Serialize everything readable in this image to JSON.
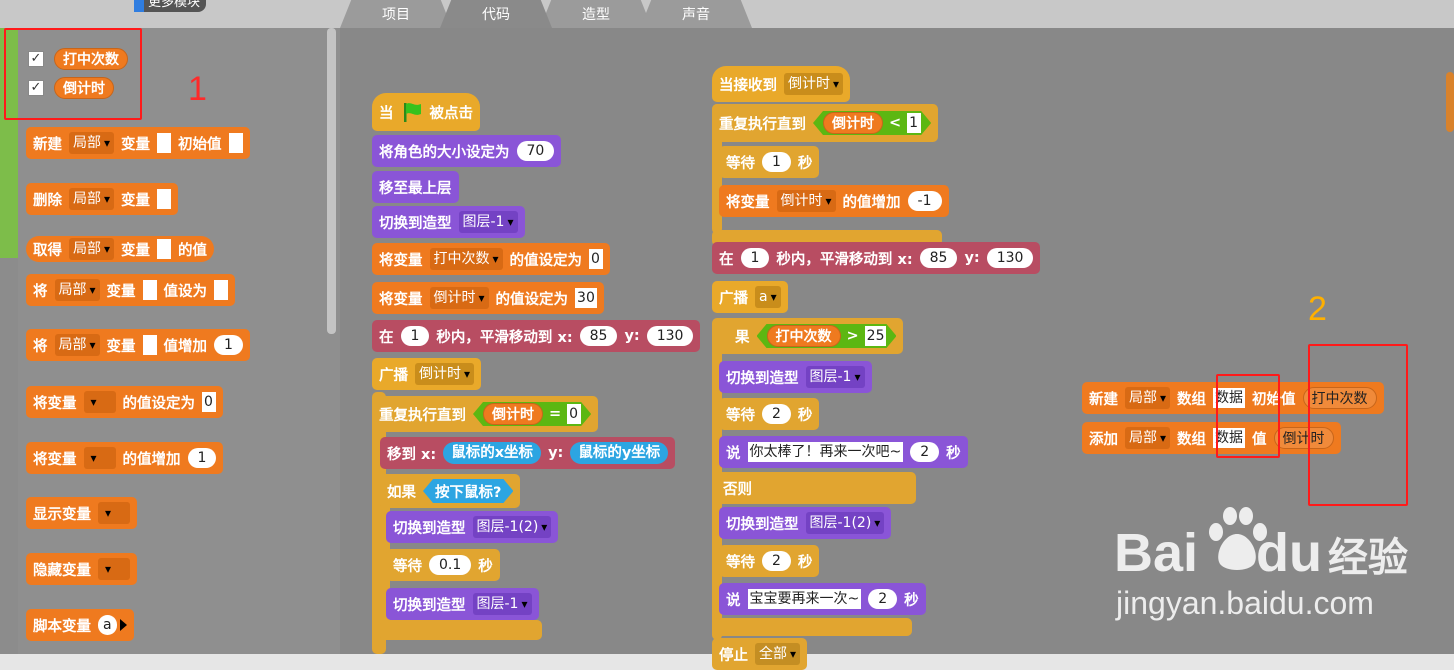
{
  "header": {
    "more_blocks": "更多模块",
    "tabs": [
      "项目",
      "代码",
      "造型",
      "声音"
    ]
  },
  "palette": {
    "var_checks": [
      {
        "label": "打中次数",
        "checked": "✓"
      },
      {
        "label": "倒计时",
        "checked": "✓"
      }
    ],
    "blocks": {
      "new_var": {
        "kw1": "新建",
        "scope": "局部",
        "kw2": "变量",
        "kw3": "初始值"
      },
      "delete_var": {
        "kw1": "删除",
        "scope": "局部",
        "kw2": "变量"
      },
      "get_var": {
        "kw1": "取得",
        "scope": "局部",
        "kw2": "变量",
        "kw3": "的值"
      },
      "set_var": {
        "kw1": "将",
        "scope": "局部",
        "kw2": "变量",
        "kw3": "值设为"
      },
      "inc_var": {
        "kw1": "将",
        "scope": "局部",
        "kw2": "变量",
        "kw3": "值增加",
        "val": "1"
      },
      "set_var2": {
        "kw1": "将变量",
        "kw2": "的值设定为",
        "val": "0"
      },
      "inc_var2": {
        "kw1": "将变量",
        "kw2": "的值增加",
        "val": "1"
      },
      "show_var": {
        "kw1": "显示变量"
      },
      "hide_var": {
        "kw1": "隐藏变量"
      },
      "script_var": {
        "kw1": "脚本变量",
        "val": "a"
      }
    }
  },
  "script1": {
    "hat": {
      "kw1": "当",
      "kw2": "被点击"
    },
    "set_size": {
      "kw": "将角色的大小设定为",
      "val": "70"
    },
    "front": {
      "kw": "移至最上层"
    },
    "switch1": {
      "kw": "切换到造型",
      "costume": "图层-1"
    },
    "set_hits": {
      "kw1": "将变量",
      "var": "打中次数",
      "kw2": "的值设定为",
      "val": "0"
    },
    "set_timer": {
      "kw1": "将变量",
      "var": "倒计时",
      "kw2": "的值设定为",
      "val": "30"
    },
    "glide": {
      "kw1": "在",
      "secs": "1",
      "kw2": "秒内，平滑移动到 x:",
      "x": "85",
      "kw3": "y:",
      "y": "130"
    },
    "broadcast": {
      "kw": "广播",
      "msg": "倒计时"
    },
    "repeat": {
      "kw": "重复执行直到",
      "var": "倒计时",
      "op": "=",
      "val": "0"
    },
    "goto": {
      "kw1": "移到 x:",
      "mx": "鼠标的x坐标",
      "kw2": "y:",
      "my": "鼠标的y坐标"
    },
    "if": {
      "kw": "如果",
      "cond": "按下鼠标?"
    },
    "switch2": {
      "kw": "切换到造型",
      "costume": "图层-1(2)"
    },
    "wait": {
      "kw1": "等待",
      "val": "0.1",
      "kw2": "秒"
    },
    "switch3": {
      "kw": "切换到造型",
      "costume": "图层-1"
    }
  },
  "script2": {
    "hat": {
      "kw": "当接收到",
      "msg": "倒计时"
    },
    "repeat": {
      "kw": "重复执行直到",
      "var": "倒计时",
      "op": "<",
      "val": "1"
    },
    "wait": {
      "kw1": "等待",
      "val": "1",
      "kw2": "秒"
    },
    "inc": {
      "kw1": "将变量",
      "var": "倒计时",
      "kw2": "的值增加",
      "val": "-1"
    },
    "glide": {
      "kw1": "在",
      "secs": "1",
      "kw2": "秒内，平滑移动到 x:",
      "x": "85",
      "kw3": "y:",
      "y": "130"
    },
    "broadcast": {
      "kw": "广播",
      "msg": "a"
    },
    "if": {
      "kw": "果",
      "var": "打中次数",
      "op": ">",
      "val": "25"
    },
    "switch1": {
      "kw": "切换到造型",
      "costume": "图层-1"
    },
    "wait1": {
      "kw1": "等待",
      "val": "2",
      "kw2": "秒"
    },
    "say1": {
      "kw1": "说",
      "text": "你太棒了！再来一次吧~",
      "val": "2",
      "kw2": "秒"
    },
    "else": {
      "kw": "否则"
    },
    "switch2": {
      "kw": "切换到造型",
      "costume": "图层-1(2)"
    },
    "wait2": {
      "kw1": "等待",
      "val": "2",
      "kw2": "秒"
    },
    "say2": {
      "kw1": "说",
      "text": "宝宝要再来一次~",
      "val": "2",
      "kw2": "秒"
    },
    "stop": {
      "kw": "停止",
      "opt": "全部"
    }
  },
  "script3": {
    "new_list": {
      "kw1": "新建",
      "scope": "局部",
      "kw2": "数组",
      "name": "数据",
      "kw3": "初始值",
      "val": "打中次数"
    },
    "add_list": {
      "kw1": "添加",
      "scope": "局部",
      "kw2": "数组",
      "name": "数据",
      "kw3": "值",
      "val": "倒计时"
    }
  },
  "annotations": {
    "label1": "1",
    "label2": "2"
  },
  "watermark": {
    "brand1": "Bai",
    "brand2": "du",
    "brand3": "经验",
    "url": "jingyan.baidu.com"
  }
}
